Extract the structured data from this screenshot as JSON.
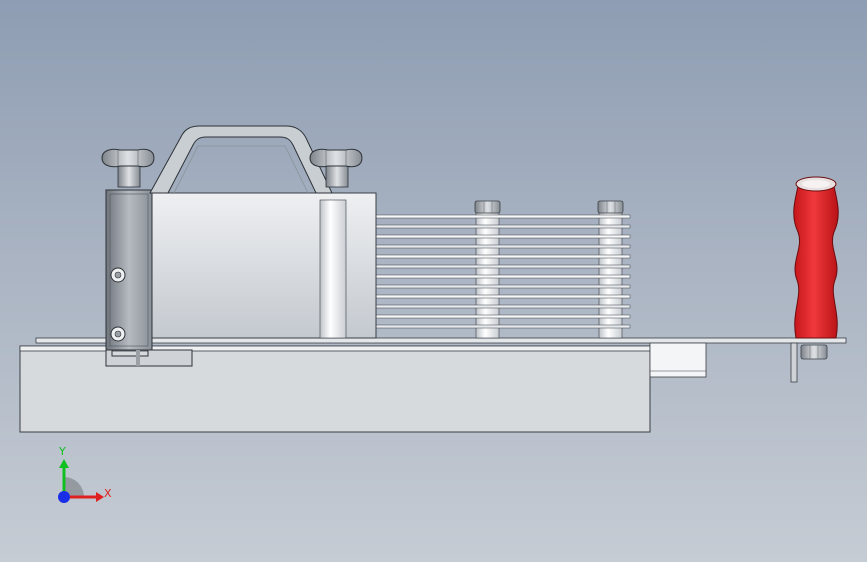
{
  "viewport": {
    "background_top": "#8e9db3",
    "background_bottom": "#c6ccd4"
  },
  "model": {
    "parts": [
      "base-plate",
      "blade-frame",
      "blade-stack",
      "press-handle",
      "knob-left",
      "knob-right",
      "hex-nut-1",
      "hex-nut-2",
      "grip-handle",
      "mounting-bracket"
    ],
    "grip_color": "#e8262a",
    "metal_color": "#d4d8dc"
  },
  "triad": {
    "x_label": "X",
    "y_label": "Y",
    "x_color": "#e02020",
    "y_color": "#10c020",
    "z_color": "#1a2ee8"
  }
}
